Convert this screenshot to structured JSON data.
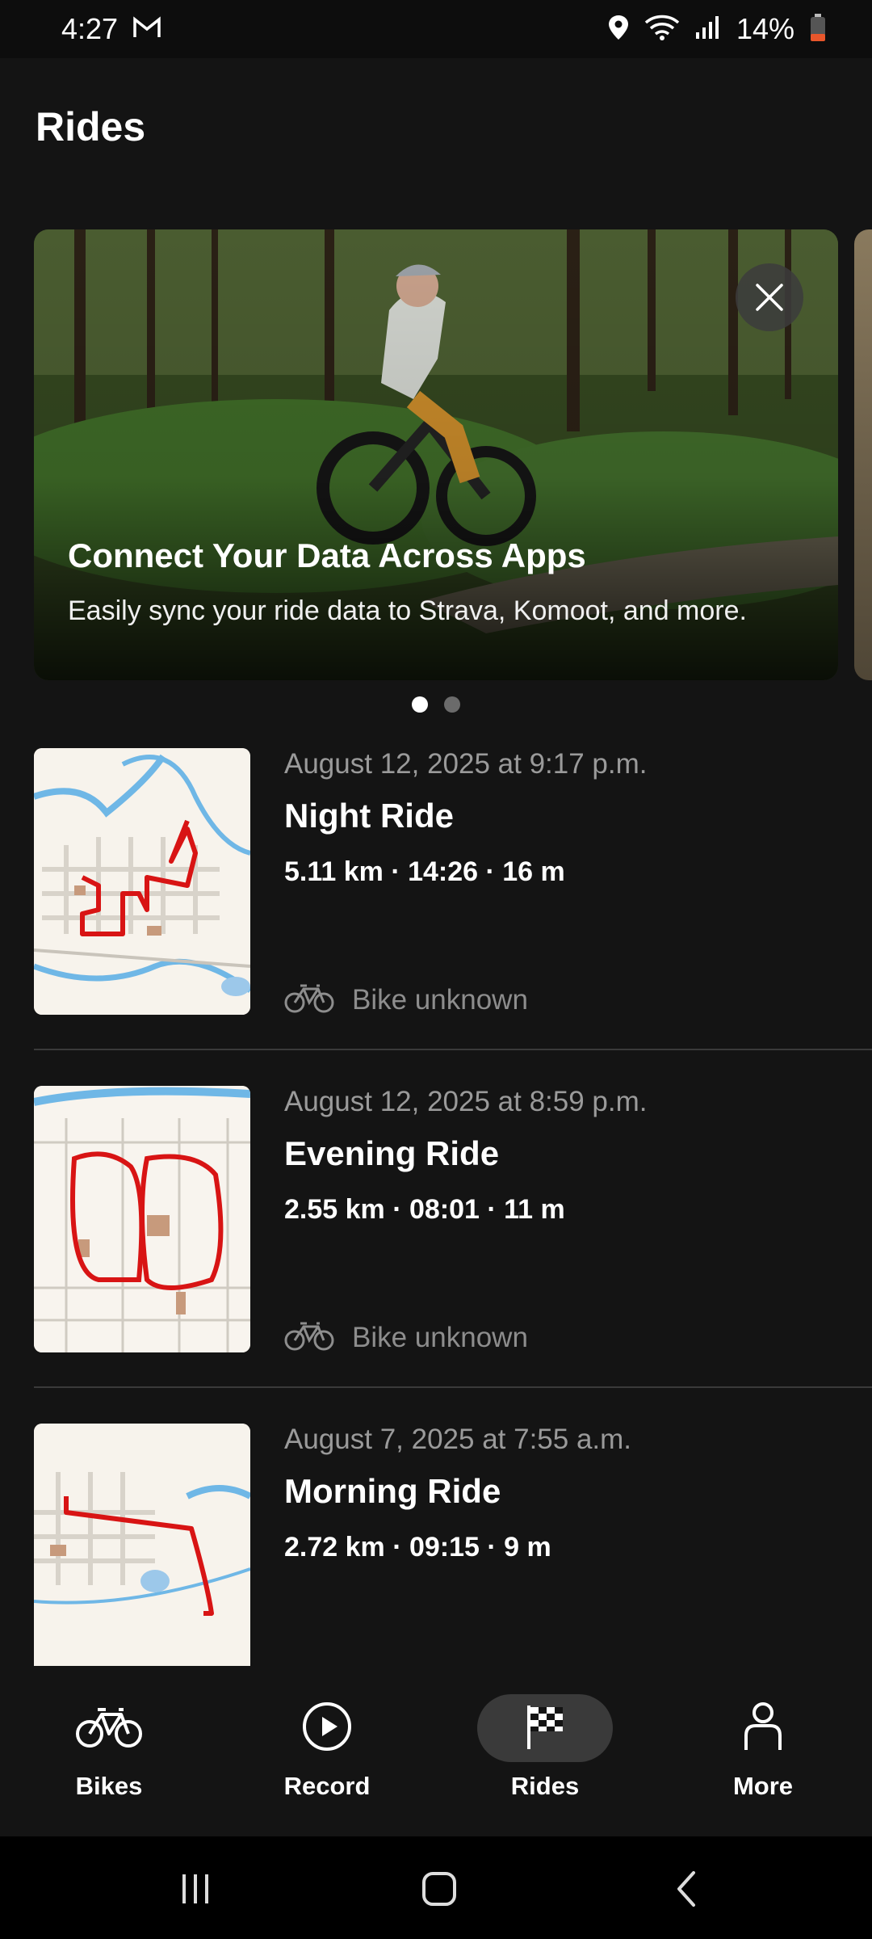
{
  "status_bar": {
    "time": "4:27",
    "battery_percent": "14%",
    "icons": [
      "gmail-icon",
      "location-icon",
      "wifi-icon",
      "signal-icon",
      "battery-low-icon"
    ]
  },
  "header": {
    "title": "Rides"
  },
  "banner": {
    "title": "Connect Your Data Across Apps",
    "subtitle": "Easily sync your ride data to Strava, Komoot, and more.",
    "page_count": 2,
    "active_page": 1
  },
  "rides": [
    {
      "date": "August 12, 2025 at 9:17 p.m.",
      "name": "Night Ride",
      "stats": "5.11 km · 14:26 · 16 m",
      "bike": "Bike unknown"
    },
    {
      "date": "August 12, 2025 at 8:59 p.m.",
      "name": "Evening Ride",
      "stats": "2.55 km · 08:01 · 11 m",
      "bike": "Bike unknown"
    },
    {
      "date": "August 7, 2025 at 7:55 a.m.",
      "name": "Morning Ride",
      "stats": "2.72 km · 09:15 · 9 m",
      "bike": ""
    }
  ],
  "bottom_nav": {
    "items": [
      {
        "label": "Bikes",
        "icon": "bicycle-icon"
      },
      {
        "label": "Record",
        "icon": "play-icon"
      },
      {
        "label": "Rides",
        "icon": "checkered-flag-icon",
        "active": true
      },
      {
        "label": "More",
        "icon": "person-icon"
      }
    ]
  },
  "colors": {
    "background": "#141414",
    "route": "#d81414",
    "active_nav_pill": "#3a3a3a",
    "secondary_text": "#9a9a9a"
  }
}
